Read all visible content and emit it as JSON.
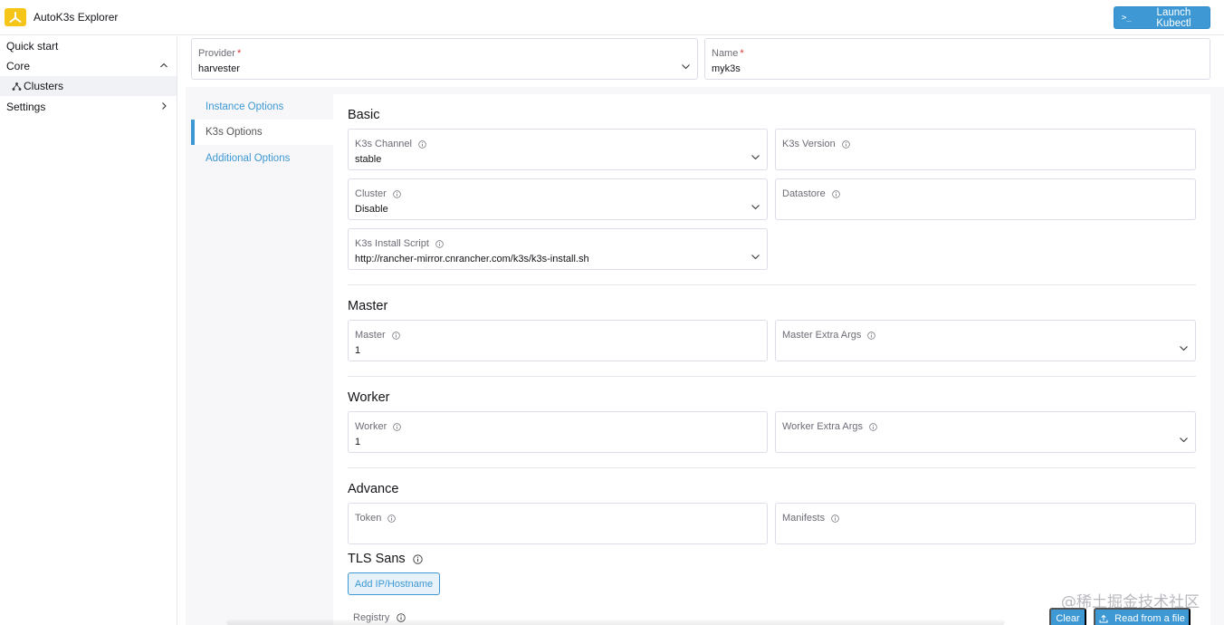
{
  "header": {
    "app_title": "AutoK3s Explorer",
    "launch_label": "Launch Kubectl",
    "launch_prefix": ">_",
    "brand_color": "#3d98d3",
    "logo_color": "#f5c518"
  },
  "sidebar": {
    "items": [
      {
        "label": "Quick start"
      },
      {
        "label": "Core",
        "expanded": true
      },
      {
        "label": "Clusters",
        "active": true
      },
      {
        "label": "Settings",
        "expanded": false
      }
    ]
  },
  "top_fields": {
    "provider": {
      "label": "Provider",
      "required_mark": "*",
      "value": "harvester"
    },
    "name": {
      "label": "Name",
      "required_mark": "*",
      "value": "myk3s"
    }
  },
  "tabs": [
    {
      "label": "Instance Options"
    },
    {
      "label": "K3s Options",
      "active": true
    },
    {
      "label": "Additional Options"
    }
  ],
  "sections": {
    "basic": {
      "title": "Basic",
      "k3s_channel": {
        "label": "K3s Channel",
        "value": "stable"
      },
      "k3s_version": {
        "label": "K3s Version",
        "value": ""
      },
      "cluster": {
        "label": "Cluster",
        "value": "Disable"
      },
      "datastore": {
        "label": "Datastore",
        "value": ""
      },
      "install_script": {
        "label": "K3s Install Script",
        "value": "http://rancher-mirror.cnrancher.com/k3s/k3s-install.sh"
      }
    },
    "master": {
      "title": "Master",
      "master": {
        "label": "Master",
        "value": "1"
      },
      "master_extra_args": {
        "label": "Master Extra Args",
        "value": ""
      }
    },
    "worker": {
      "title": "Worker",
      "worker": {
        "label": "Worker",
        "value": "1"
      },
      "worker_extra_args": {
        "label": "Worker Extra Args",
        "value": ""
      }
    },
    "advance": {
      "title": "Advance",
      "token": {
        "label": "Token",
        "value": ""
      },
      "manifests": {
        "label": "Manifests",
        "value": ""
      },
      "tls_sans_title": "TLS Sans",
      "add_host_label": "Add IP/Hostname",
      "registry_label": "Registry"
    }
  },
  "footer": {
    "clear_label": "Clear",
    "read_file_label": "Read from a file",
    "watermark": "@稀土掘金技术社区"
  }
}
